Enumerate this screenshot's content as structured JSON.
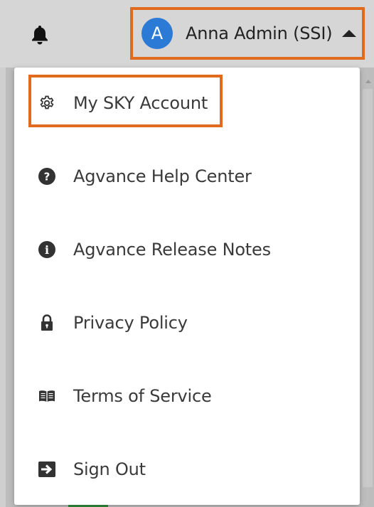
{
  "header": {
    "user": {
      "avatar_initial": "A",
      "name": "Anna Admin (SSI)"
    }
  },
  "menu": {
    "items": [
      {
        "label": "My SKY Account",
        "icon": "gear-icon"
      },
      {
        "label": "Agvance Help Center",
        "icon": "question-circle-icon"
      },
      {
        "label": "Agvance Release Notes",
        "icon": "info-circle-icon"
      },
      {
        "label": "Privacy Policy",
        "icon": "lock-icon"
      },
      {
        "label": "Terms of Service",
        "icon": "book-icon"
      },
      {
        "label": "Sign Out",
        "icon": "sign-out-icon"
      }
    ]
  },
  "colors": {
    "highlight": "#e06a1e",
    "avatar": "#2b7bd6",
    "icon": "#333333"
  }
}
